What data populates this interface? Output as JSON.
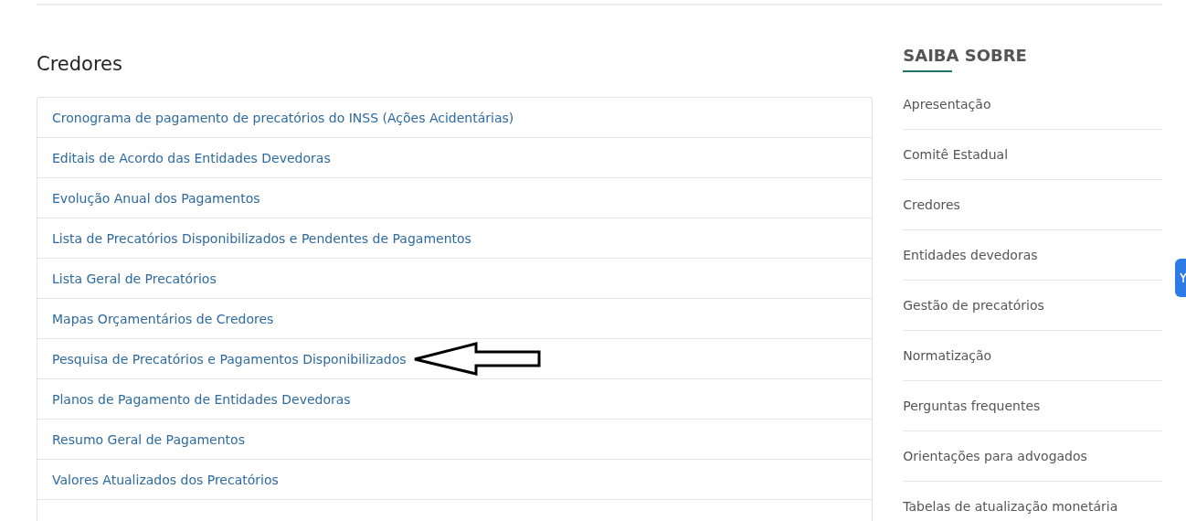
{
  "main": {
    "title": "Credores",
    "links": [
      {
        "label": "Cronograma de pagamento de precatórios do INSS (Ações Acidentárias)",
        "marked": false
      },
      {
        "label": "Editais de Acordo das Entidades Devedoras",
        "marked": false
      },
      {
        "label": "Evolução Anual dos Pagamentos",
        "marked": false
      },
      {
        "label": "Lista de Precatórios Disponibilizados e Pendentes de Pagamentos",
        "marked": false
      },
      {
        "label": "Lista Geral de Precatórios",
        "marked": false
      },
      {
        "label": "Mapas Orçamentários de Credores",
        "marked": false
      },
      {
        "label": "Pesquisa de Precatórios e Pagamentos Disponibilizados",
        "marked": true
      },
      {
        "label": "Planos de Pagamento de Entidades Devedoras",
        "marked": false
      },
      {
        "label": "Resumo Geral de Pagamentos",
        "marked": false
      },
      {
        "label": "Valores Atualizados dos Precatórios",
        "marked": false
      }
    ]
  },
  "sidebar": {
    "title": "SAIBA SOBRE",
    "items": [
      "Apresentação",
      "Comitê Estadual",
      "Credores",
      "Entidades devedoras",
      "Gestão de precatórios",
      "Normatização",
      "Perguntas frequentes",
      "Orientações para advogados",
      "Tabelas de atualização monetária"
    ]
  }
}
